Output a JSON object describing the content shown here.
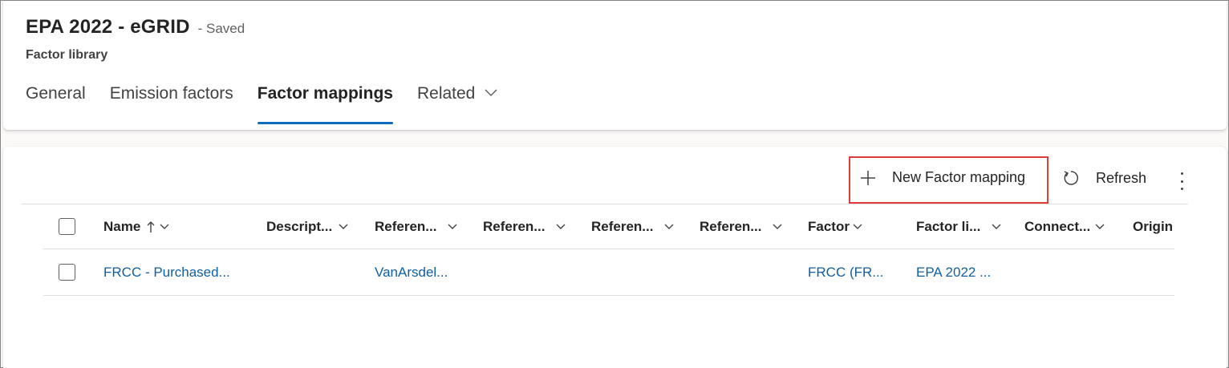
{
  "header": {
    "title": "EPA 2022 - eGRID",
    "save_status": "- Saved",
    "entity_name": "Factor library"
  },
  "tabs": [
    {
      "label": "General",
      "active": false
    },
    {
      "label": "Emission factors",
      "active": false
    },
    {
      "label": "Factor mappings",
      "active": true
    },
    {
      "label": "Related",
      "active": false,
      "has_dropdown": true
    }
  ],
  "command_bar": {
    "new_label": "New Factor mapping",
    "refresh_label": "Refresh",
    "more_icon": "more-vertical-icon"
  },
  "grid": {
    "columns": [
      {
        "label": "Name",
        "sort": "ascending"
      },
      {
        "label": "Descript..."
      },
      {
        "label": "Referen..."
      },
      {
        "label": "Referen..."
      },
      {
        "label": "Referen..."
      },
      {
        "label": "Referen..."
      },
      {
        "label": "Factor"
      },
      {
        "label": "Factor li..."
      },
      {
        "label": "Connect..."
      },
      {
        "label": "Origin"
      }
    ],
    "rows": [
      {
        "name": "FRCC - Purchased...",
        "description": "",
        "reference1": "VanArsdel...",
        "reference2": "",
        "reference3": "",
        "reference4": "",
        "factor": "FRCC (FR...",
        "factor_library": "EPA 2022 ...",
        "connection": "",
        "origin": ""
      }
    ]
  },
  "colors": {
    "accent": "#0f6cbd",
    "link": "#115ea3",
    "highlight_box": "#e03c3c"
  }
}
